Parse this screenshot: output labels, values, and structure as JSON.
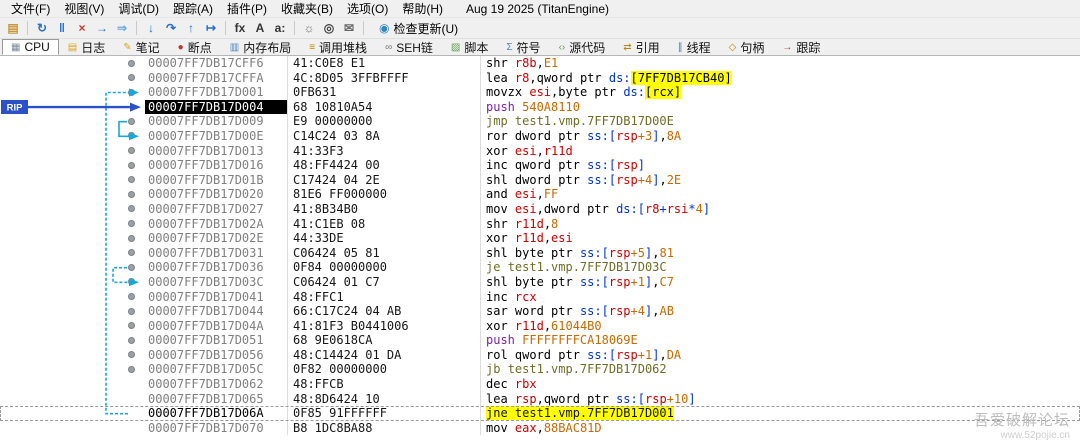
{
  "window": {
    "title_text": "Aug 19 2025 (TitanEngine)"
  },
  "menu": {
    "items": [
      "文件(F)",
      "视图(V)",
      "调试(D)",
      "跟踪(A)",
      "插件(P)",
      "收藏夹(B)",
      "选项(O)",
      "帮助(H)"
    ]
  },
  "toolbar": {
    "icons": [
      {
        "name": "open-folder-icon",
        "glyph": "▤",
        "color": "#c9973b",
        "sep_after": true
      },
      {
        "name": "restart-icon",
        "glyph": "↻",
        "color": "#2b6fc4"
      },
      {
        "name": "pause-icon",
        "glyph": "‖",
        "color": "#2b6fc4"
      },
      {
        "name": "stop-icon",
        "glyph": "×",
        "color": "#c0392b"
      },
      {
        "name": "run-icon",
        "glyph": "→",
        "color": "#2b6fc4"
      },
      {
        "name": "run-ignore-exceptions-icon",
        "glyph": "⇒",
        "color": "#6fa8dc",
        "sep_after": true
      },
      {
        "name": "step-into-icon",
        "glyph": "↓",
        "color": "#2b6fc4"
      },
      {
        "name": "step-over-icon",
        "glyph": "↷",
        "color": "#2b6fc4"
      },
      {
        "name": "step-out-icon",
        "glyph": "↑",
        "color": "#2b6fc4"
      },
      {
        "name": "skip-icon",
        "glyph": "↦",
        "color": "#2b6fc4",
        "sep_after": true
      },
      {
        "name": "assemble-fx-icon",
        "glyph": "fx",
        "color": "#333333"
      },
      {
        "name": "text-a-icon",
        "glyph": "A",
        "color": "#333333"
      },
      {
        "name": "font-az-icon",
        "glyph": "a:",
        "color": "#333333",
        "sep_after": true
      },
      {
        "name": "settings-gear-icon",
        "glyph": "☼",
        "color": "#666666"
      },
      {
        "name": "search-binoculars-icon",
        "glyph": "◎",
        "color": "#444444"
      },
      {
        "name": "comment-icon",
        "glyph": "✉",
        "color": "#666666",
        "sep_after": true
      }
    ],
    "update_button": {
      "label": "检查更新(U)"
    }
  },
  "tabs": [
    {
      "name": "tab-cpu",
      "label": "CPU",
      "glyph": "▦",
      "color": "#7d8796",
      "active": true
    },
    {
      "name": "tab-log",
      "label": "日志",
      "glyph": "▤",
      "color": "#d9a520"
    },
    {
      "name": "tab-notes",
      "label": "笔记",
      "glyph": "✎",
      "color": "#d9a520"
    },
    {
      "name": "tab-breakpoints",
      "label": "断点",
      "glyph": "●",
      "color": "#b23b3b"
    },
    {
      "name": "tab-memory-map",
      "label": "内存布局",
      "glyph": "▥",
      "color": "#4f81bd"
    },
    {
      "name": "tab-call-stack",
      "label": "调用堆栈",
      "glyph": "≡",
      "color": "#b8860b"
    },
    {
      "name": "tab-seh-chain",
      "label": "SEH链",
      "glyph": "∞",
      "color": "#777777"
    },
    {
      "name": "tab-script",
      "label": "脚本",
      "glyph": "▨",
      "color": "#5f9e4f"
    },
    {
      "name": "tab-symbols",
      "label": "符号",
      "glyph": "Σ",
      "color": "#4f81bd"
    },
    {
      "name": "tab-source",
      "label": "源代码",
      "glyph": "‹›",
      "color": "#5f9e4f"
    },
    {
      "name": "tab-references",
      "label": "引用",
      "glyph": "⇄",
      "color": "#b8860b"
    },
    {
      "name": "tab-threads",
      "label": "线程",
      "glyph": "∥",
      "color": "#4f81bd"
    },
    {
      "name": "tab-handles",
      "label": "句柄",
      "glyph": "◇",
      "color": "#b8860b"
    },
    {
      "name": "tab-trace",
      "label": "跟踪",
      "glyph": "→",
      "color": "#b23b3b"
    }
  ],
  "disasm": {
    "rip_label": "RIP",
    "rows": [
      {
        "addr": "00007FF7DB17CFF6",
        "bytes": "41:C0E8 E1",
        "bp": true,
        "tokens": [
          [
            "mn",
            "shr "
          ],
          [
            "reg",
            "r8b"
          ],
          [
            "pl",
            ","
          ],
          [
            "imm",
            "E1"
          ]
        ]
      },
      {
        "addr": "00007FF7DB17CFFA",
        "bytes": "4C:8D05 3FFBFFFF",
        "bp": true,
        "tokens": [
          [
            "mn",
            "lea "
          ],
          [
            "reg",
            "r8"
          ],
          [
            "pl",
            ","
          ],
          [
            "kw",
            "qword ptr "
          ],
          [
            "seg",
            "ds:"
          ],
          [
            "hl",
            "[7FF7DB17CB40]"
          ]
        ]
      },
      {
        "addr": "00007FF7DB17D001",
        "bytes": "0FB631",
        "bp": true,
        "tokens": [
          [
            "mn",
            "movzx "
          ],
          [
            "reg",
            "esi"
          ],
          [
            "pl",
            ","
          ],
          [
            "kw",
            "byte ptr "
          ],
          [
            "seg",
            "ds:"
          ],
          [
            "hl",
            "[rcx]"
          ]
        ]
      },
      {
        "addr": "00007FF7DB17D004",
        "bytes": "68 10810A54",
        "bp": false,
        "rip": true,
        "tokens": [
          [
            "pu",
            "push "
          ],
          [
            "imm",
            "540A8110"
          ]
        ]
      },
      {
        "addr": "00007FF7DB17D009",
        "bytes": "E9 00000000",
        "bp": true,
        "tokens": [
          [
            "jm",
            "jmp "
          ],
          [
            "jt",
            "test1.vmp.7FF7DB17D00E"
          ]
        ]
      },
      {
        "addr": "00007FF7DB17D00E",
        "bytes": "C14C24 03 8A",
        "bp": true,
        "tokens": [
          [
            "mn",
            "ror "
          ],
          [
            "kw",
            "dword ptr "
          ],
          [
            "seg",
            "ss:"
          ],
          [
            "br",
            "["
          ],
          [
            "reg",
            "rsp"
          ],
          [
            "imm",
            "+3"
          ],
          [
            "br",
            "]"
          ],
          [
            "pl",
            ","
          ],
          [
            "imm",
            "8A"
          ]
        ]
      },
      {
        "addr": "00007FF7DB17D013",
        "bytes": "41:33F3",
        "bp": true,
        "tokens": [
          [
            "mn",
            "xor "
          ],
          [
            "reg",
            "esi"
          ],
          [
            "pl",
            ","
          ],
          [
            "reg",
            "r11d"
          ]
        ]
      },
      {
        "addr": "00007FF7DB17D016",
        "bytes": "48:FF4424 00",
        "bp": true,
        "tokens": [
          [
            "mn",
            "inc "
          ],
          [
            "kw",
            "qword ptr "
          ],
          [
            "seg",
            "ss:"
          ],
          [
            "br",
            "["
          ],
          [
            "reg",
            "rsp"
          ],
          [
            "br",
            "]"
          ]
        ]
      },
      {
        "addr": "00007FF7DB17D01B",
        "bytes": "C17424 04 2E",
        "bp": true,
        "tokens": [
          [
            "mn",
            "shl "
          ],
          [
            "kw",
            "dword ptr "
          ],
          [
            "seg",
            "ss:"
          ],
          [
            "br",
            "["
          ],
          [
            "reg",
            "rsp"
          ],
          [
            "imm",
            "+4"
          ],
          [
            "br",
            "]"
          ],
          [
            "pl",
            ","
          ],
          [
            "imm",
            "2E"
          ]
        ]
      },
      {
        "addr": "00007FF7DB17D020",
        "bytes": "81E6 FF000000",
        "bp": true,
        "tokens": [
          [
            "mn",
            "and "
          ],
          [
            "reg",
            "esi"
          ],
          [
            "pl",
            ","
          ],
          [
            "imm",
            "FF"
          ]
        ]
      },
      {
        "addr": "00007FF7DB17D027",
        "bytes": "41:8B34B0",
        "bp": true,
        "tokens": [
          [
            "mn",
            "mov "
          ],
          [
            "reg",
            "esi"
          ],
          [
            "pl",
            ","
          ],
          [
            "kw",
            "dword ptr "
          ],
          [
            "seg",
            "ds:"
          ],
          [
            "br",
            "["
          ],
          [
            "reg",
            "r8"
          ],
          [
            "br",
            "+"
          ],
          [
            "reg",
            "rsi"
          ],
          [
            "br",
            "*"
          ],
          [
            "imm",
            "4"
          ],
          [
            "br",
            "]"
          ]
        ]
      },
      {
        "addr": "00007FF7DB17D02A",
        "bytes": "41:C1EB 08",
        "bp": true,
        "tokens": [
          [
            "mn",
            "shr "
          ],
          [
            "reg",
            "r11d"
          ],
          [
            "pl",
            ","
          ],
          [
            "imm",
            "8"
          ]
        ]
      },
      {
        "addr": "00007FF7DB17D02E",
        "bytes": "44:33DE",
        "bp": true,
        "tokens": [
          [
            "mn",
            "xor "
          ],
          [
            "reg",
            "r11d"
          ],
          [
            "pl",
            ","
          ],
          [
            "reg",
            "esi"
          ]
        ]
      },
      {
        "addr": "00007FF7DB17D031",
        "bytes": "C06424 05 81",
        "bp": true,
        "tokens": [
          [
            "mn",
            "shl "
          ],
          [
            "kw",
            "byte ptr "
          ],
          [
            "seg",
            "ss:"
          ],
          [
            "br",
            "["
          ],
          [
            "reg",
            "rsp"
          ],
          [
            "imm",
            "+5"
          ],
          [
            "br",
            "]"
          ],
          [
            "pl",
            ","
          ],
          [
            "imm",
            "81"
          ]
        ]
      },
      {
        "addr": "00007FF7DB17D036",
        "bytes": "0F84 00000000",
        "bp": true,
        "tokens": [
          [
            "jm",
            "je "
          ],
          [
            "jt",
            "test1.vmp.7FF7DB17D03C"
          ]
        ]
      },
      {
        "addr": "00007FF7DB17D03C",
        "bytes": "C06424 01 C7",
        "bp": true,
        "tokens": [
          [
            "mn",
            "shl "
          ],
          [
            "kw",
            "byte ptr "
          ],
          [
            "seg",
            "ss:"
          ],
          [
            "br",
            "["
          ],
          [
            "reg",
            "rsp"
          ],
          [
            "imm",
            "+1"
          ],
          [
            "br",
            "]"
          ],
          [
            "pl",
            ","
          ],
          [
            "imm",
            "C7"
          ]
        ]
      },
      {
        "addr": "00007FF7DB17D041",
        "bytes": "48:FFC1",
        "bp": true,
        "tokens": [
          [
            "mn",
            "inc "
          ],
          [
            "reg",
            "rcx"
          ]
        ]
      },
      {
        "addr": "00007FF7DB17D044",
        "bytes": "66:C17C24 04 AB",
        "bp": true,
        "tokens": [
          [
            "mn",
            "sar "
          ],
          [
            "kw",
            "word ptr "
          ],
          [
            "seg",
            "ss:"
          ],
          [
            "br",
            "["
          ],
          [
            "reg",
            "rsp"
          ],
          [
            "imm",
            "+4"
          ],
          [
            "br",
            "]"
          ],
          [
            "pl",
            ","
          ],
          [
            "imm",
            "AB"
          ]
        ]
      },
      {
        "addr": "00007FF7DB17D04A",
        "bytes": "41:81F3 B0441006",
        "bp": true,
        "tokens": [
          [
            "mn",
            "xor "
          ],
          [
            "reg",
            "r11d"
          ],
          [
            "pl",
            ","
          ],
          [
            "imm",
            "61044B0"
          ]
        ]
      },
      {
        "addr": "00007FF7DB17D051",
        "bytes": "68 9E0618CA",
        "bp": true,
        "tokens": [
          [
            "pu",
            "push "
          ],
          [
            "imm",
            "FFFFFFFFCA18069E"
          ]
        ]
      },
      {
        "addr": "00007FF7DB17D056",
        "bytes": "48:C14424 01 DA",
        "bp": true,
        "tokens": [
          [
            "mn",
            "rol "
          ],
          [
            "kw",
            "qword ptr "
          ],
          [
            "seg",
            "ss:"
          ],
          [
            "br",
            "["
          ],
          [
            "reg",
            "rsp"
          ],
          [
            "imm",
            "+1"
          ],
          [
            "br",
            "]"
          ],
          [
            "pl",
            ","
          ],
          [
            "imm",
            "DA"
          ]
        ]
      },
      {
        "addr": "00007FF7DB17D05C",
        "bytes": "0F82 00000000",
        "bp": true,
        "tokens": [
          [
            "jm",
            "jb "
          ],
          [
            "jt",
            "test1.vmp.7FF7DB17D062"
          ]
        ]
      },
      {
        "addr": "00007FF7DB17D062",
        "bytes": "48:FFCB",
        "bp": false,
        "tokens": [
          [
            "mn",
            "dec "
          ],
          [
            "reg",
            "rbx"
          ]
        ]
      },
      {
        "addr": "00007FF7DB17D065",
        "bytes": "48:8D6424 10",
        "bp": false,
        "tokens": [
          [
            "mn",
            "lea "
          ],
          [
            "reg",
            "rsp"
          ],
          [
            "pl",
            ","
          ],
          [
            "kw",
            "qword ptr "
          ],
          [
            "seg",
            "ss:"
          ],
          [
            "br",
            "["
          ],
          [
            "reg",
            "rsp"
          ],
          [
            "imm",
            "+10"
          ],
          [
            "br",
            "]"
          ]
        ]
      },
      {
        "addr": "00007FF7DB17D06A",
        "bytes": "0F85 91FFFFFF",
        "bp": false,
        "sel": true,
        "tokens": [
          [
            "jm",
            "jne "
          ],
          [
            "jt",
            "test1.vmp.7FF7DB17D001"
          ]
        ]
      },
      {
        "addr": "00007FF7DB17D070",
        "bytes": "B8 1DC8BA88",
        "bp": false,
        "tokens": [
          [
            "mn",
            "mov "
          ],
          [
            "reg",
            "eax"
          ],
          [
            "pl",
            ","
          ],
          [
            "imm",
            "88BAC81D"
          ]
        ]
      }
    ]
  },
  "watermark": {
    "line1": "吾爱破解论坛",
    "line2": "www.52pojie.cn"
  },
  "colors": {
    "highlight_yellow": "#ffff00",
    "register_red": "#cc0000",
    "immediate_orange": "#c66a00",
    "segment_blue": "#0033cc",
    "push_purple": "#7b1fa2",
    "jump_olive": "#6e6e28",
    "address_gray": "#7f7f7f",
    "breakpoint_dot_gray": "#9aa0a6",
    "jump_arrow_cyan": "#18a7dd",
    "rip_arrow_blue": "#2b50c8",
    "rip_row_black": "#000000",
    "rip_row_text_white": "#ffffff"
  }
}
